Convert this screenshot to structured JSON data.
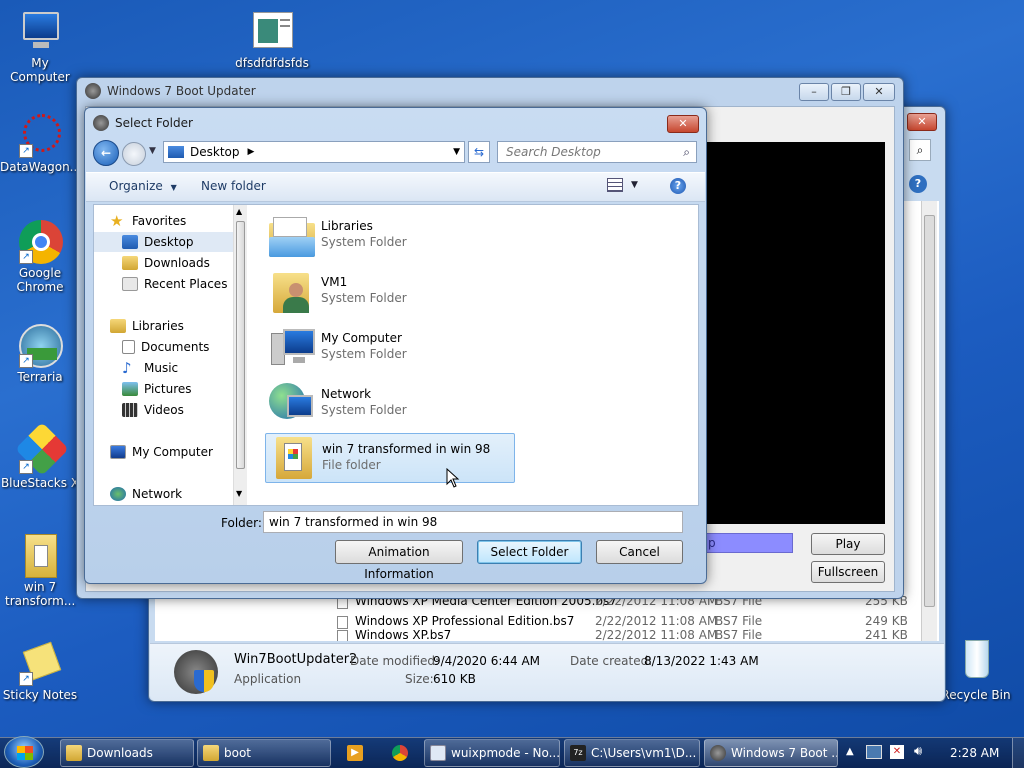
{
  "desktop": {
    "icons": [
      {
        "label": "My Computer"
      },
      {
        "label": "dfsdfdfdsfds"
      },
      {
        "label": "DataWagon..."
      },
      {
        "label": "Google Chrome"
      },
      {
        "label": "Terraria"
      },
      {
        "label": "BlueStacks X"
      },
      {
        "label": "win 7 transform..."
      },
      {
        "label": "Sticky Notes"
      },
      {
        "label": "Recycle Bin"
      }
    ]
  },
  "boot_updater": {
    "title": "Windows 7 Boot Updater",
    "play_label": "Play",
    "fullscreen_label": "Fullscreen",
    "progress_text": "p"
  },
  "explorer_bg": {
    "files": [
      {
        "name": "Windows XP Media Center Edition 2005.bs7",
        "date": "2/22/2012 11:08 AM",
        "type": "BS7 File",
        "size": "255 KB"
      },
      {
        "name": "Windows XP Professional Edition.bs7",
        "date": "2/22/2012 11:08 AM",
        "type": "BS7 File",
        "size": "249 KB"
      },
      {
        "name": "Windows XP.bs7",
        "date": "2/22/2012 11:08 AM",
        "type": "BS7 File",
        "size": "241 KB"
      }
    ],
    "details": {
      "name": "Win7BootUpdater2",
      "kind": "Application",
      "modified_label": "Date modified:",
      "modified": "9/4/2020 6:44 AM",
      "created_label": "Date created:",
      "created": "8/13/2022 1:43 AM",
      "size_label": "Size:",
      "size": "610 KB"
    }
  },
  "dialog": {
    "title": "Select Folder",
    "address": "Desktop",
    "search_placeholder": "Search Desktop",
    "organize_label": "Organize",
    "new_folder_label": "New folder",
    "nav": {
      "favorites": "Favorites",
      "desktop": "Desktop",
      "downloads": "Downloads",
      "recent": "Recent Places",
      "libraries": "Libraries",
      "documents": "Documents",
      "music": "Music",
      "pictures": "Pictures",
      "videos": "Videos",
      "computer": "My Computer",
      "network": "Network"
    },
    "items": [
      {
        "name": "Libraries",
        "type": "System Folder"
      },
      {
        "name": "VM1",
        "type": "System Folder"
      },
      {
        "name": "My Computer",
        "type": "System Folder"
      },
      {
        "name": "Network",
        "type": "System Folder"
      },
      {
        "name": "win 7 transformed in win 98",
        "type": "File folder"
      }
    ],
    "folder_label": "Folder:",
    "folder_value": "win 7 transformed in win 98",
    "anim_info_label": "Animation Information",
    "select_label": "Select Folder",
    "cancel_label": "Cancel"
  },
  "taskbar": {
    "items": [
      {
        "label": "Downloads"
      },
      {
        "label": "boot"
      },
      {
        "label": "wuixpmode - No..."
      },
      {
        "label": "C:\\Users\\vm1\\D..."
      },
      {
        "label": "Windows 7 Boot ..."
      }
    ],
    "clock": "2:28 AM"
  }
}
